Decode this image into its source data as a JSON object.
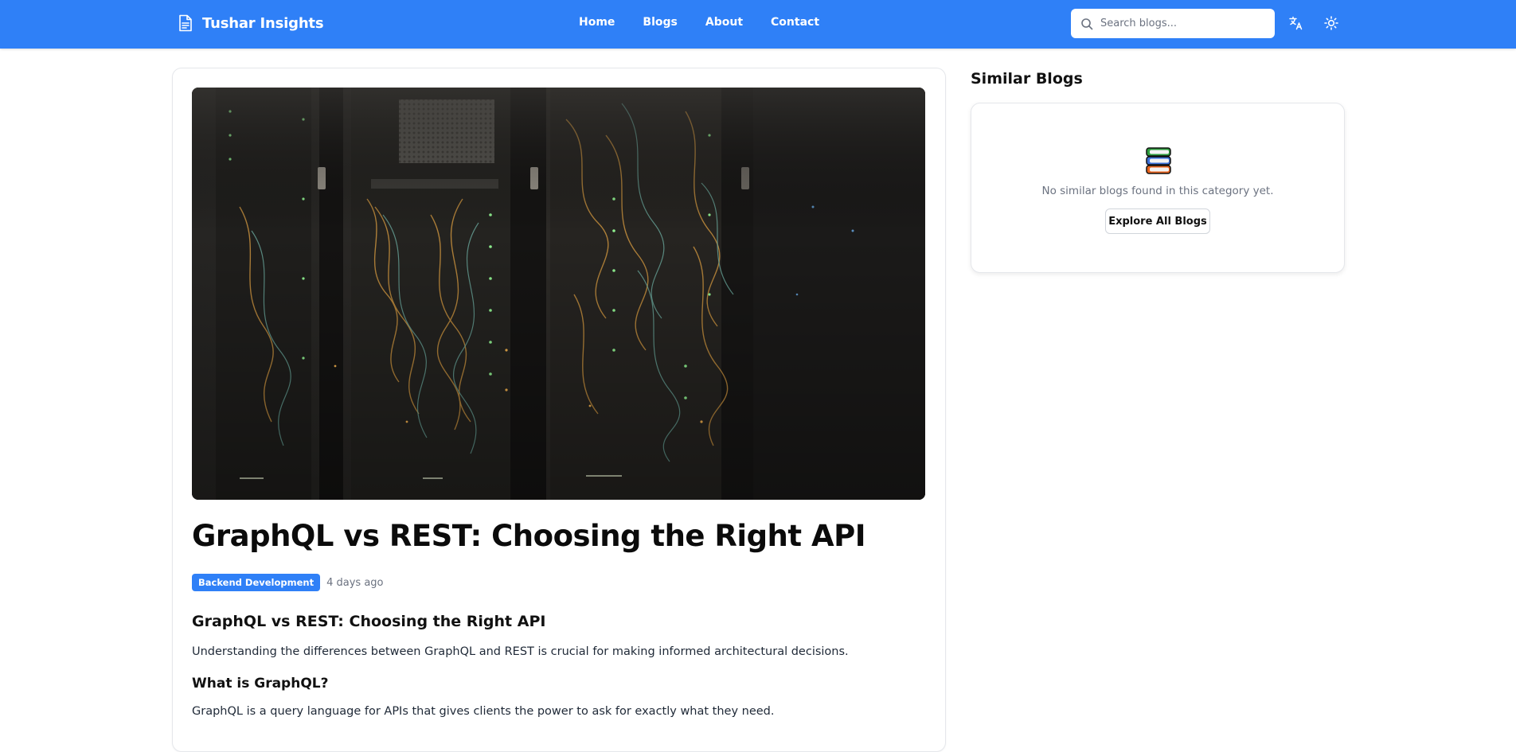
{
  "header": {
    "brand": "Tushar Insights",
    "nav": [
      "Home",
      "Blogs",
      "About",
      "Contact"
    ],
    "search_placeholder": "Search blogs..."
  },
  "article": {
    "title": "GraphQL vs REST: Choosing the Right API",
    "category": "Backend Development",
    "posted": "4 days ago",
    "heading": "GraphQL vs REST: Choosing the Right API",
    "intro": "Understanding the differences between GraphQL and REST is crucial for making informed architectural decisions.",
    "subheading": "What is GraphQL?",
    "paragraph": "GraphQL is a query language for APIs that gives clients the power to ask for exactly what they need."
  },
  "sidebar": {
    "title": "Similar Blogs",
    "empty_message": "No similar blogs found in this category yet.",
    "button": "Explore All Blogs"
  },
  "colors": {
    "primary": "#2f80f7",
    "badge": "#2f80f7"
  }
}
